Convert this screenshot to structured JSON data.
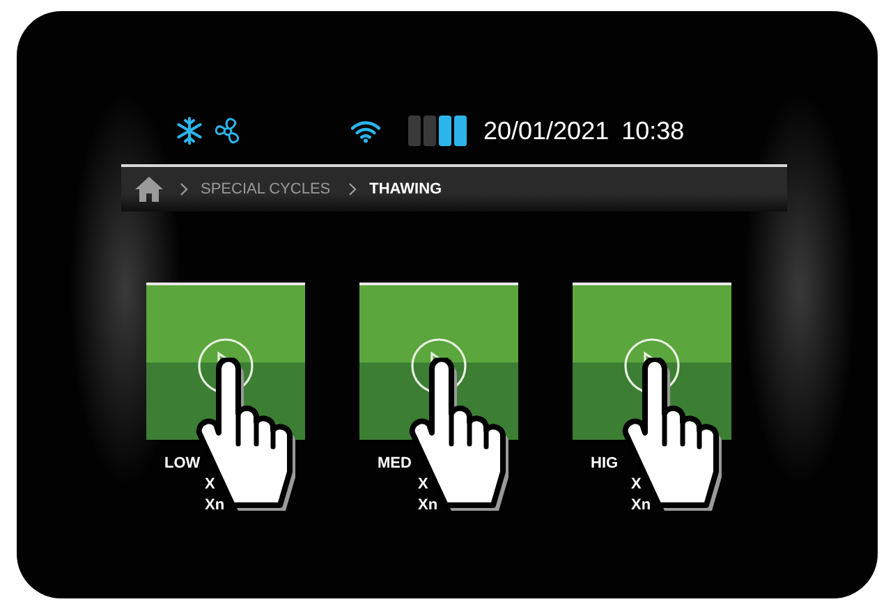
{
  "status_bar": {
    "date": "20/01/2021",
    "time": "10:38"
  },
  "breadcrumb": [
    {
      "label": "SPECIAL CYCLES",
      "current": false
    },
    {
      "label": "THAWING",
      "current": true
    }
  ],
  "cycles": [
    {
      "label": "LOW",
      "line_2": "X",
      "line_3": "Xn"
    },
    {
      "label": "MED",
      "line_2": "X",
      "line_3": "Xn"
    },
    {
      "label": "HIG",
      "line_2": "X",
      "line_3": "Xn"
    }
  ]
}
